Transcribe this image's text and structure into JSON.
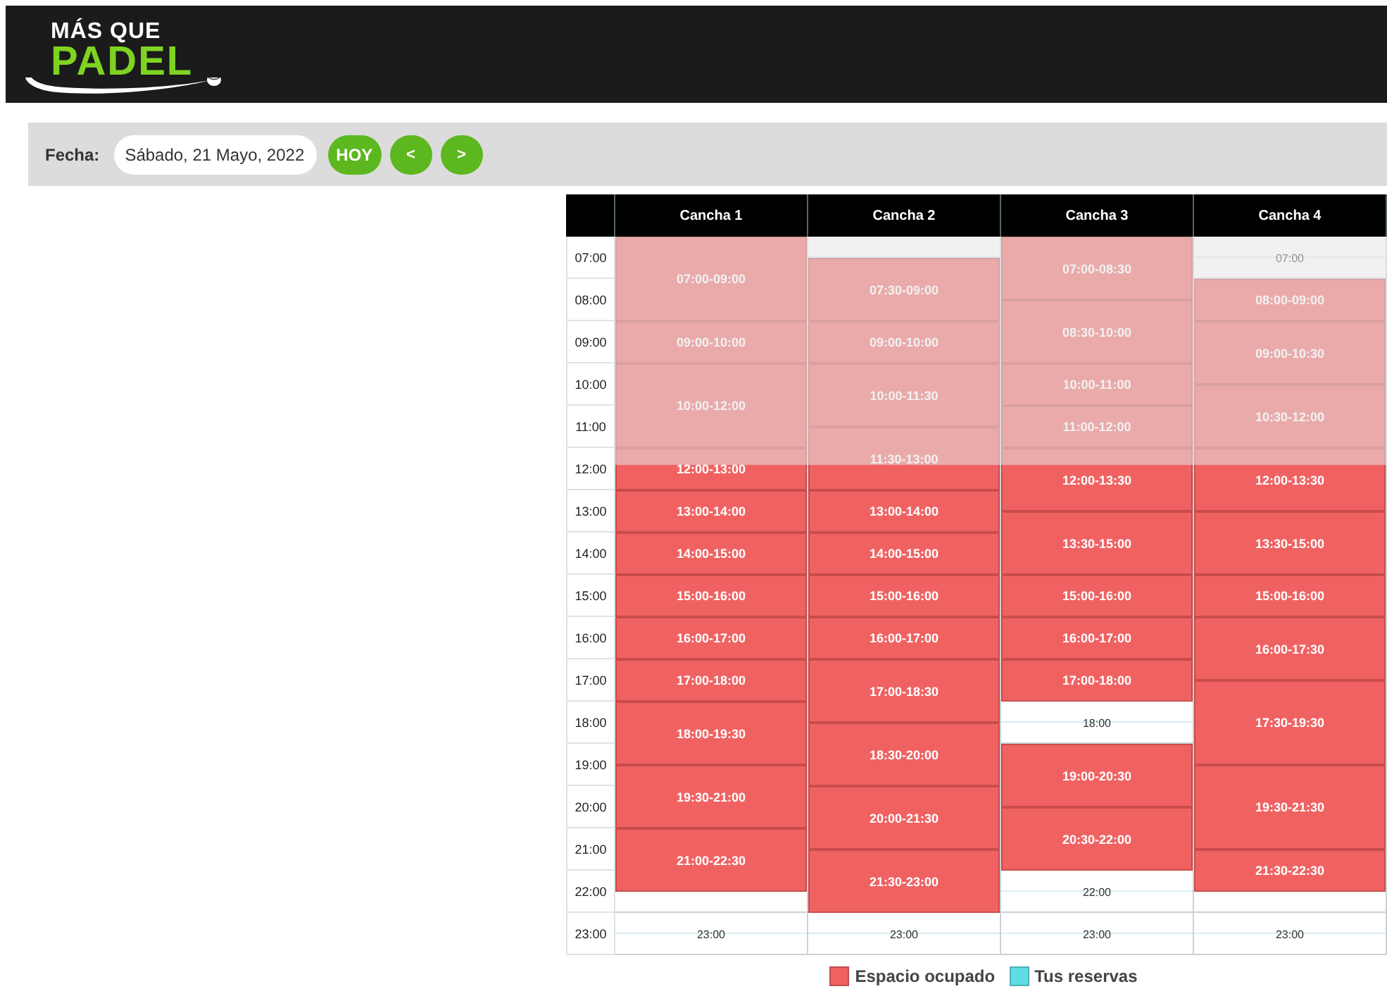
{
  "logo": {
    "line1": "MÁS QUE",
    "line2": "PADEL"
  },
  "toolbar": {
    "label": "Fecha:",
    "date_value": "Sábado, 21 Mayo, 2022",
    "buttons": [
      "HOY",
      "<",
      ">"
    ]
  },
  "schedule": {
    "hours": [
      "07:00",
      "08:00",
      "09:00",
      "10:00",
      "11:00",
      "12:00",
      "13:00",
      "14:00",
      "15:00",
      "16:00",
      "17:00",
      "18:00",
      "19:00",
      "20:00",
      "21:00",
      "22:00",
      "23:00"
    ],
    "courts": [
      {
        "name": "Cancha 1",
        "free_slots": [
          "23:00"
        ],
        "bookings": [
          "07:00-09:00",
          "09:00-10:00",
          "10:00-12:00",
          "12:00-13:00",
          "13:00-14:00",
          "14:00-15:00",
          "15:00-16:00",
          "16:00-17:00",
          "17:00-18:00",
          "18:00-19:30",
          "19:30-21:00",
          "21:00-22:30"
        ]
      },
      {
        "name": "Cancha 2",
        "free_slots": [
          "23:00"
        ],
        "bookings": [
          "07:30-09:00",
          "09:00-10:00",
          "10:00-11:30",
          "11:30-13:00",
          "13:00-14:00",
          "14:00-15:00",
          "15:00-16:00",
          "16:00-17:00",
          "17:00-18:30",
          "18:30-20:00",
          "20:00-21:30",
          "21:30-23:00"
        ]
      },
      {
        "name": "Cancha 3",
        "free_slots": [
          "18:00",
          "22:00",
          "23:00"
        ],
        "bookings": [
          "07:00-08:30",
          "08:30-10:00",
          "10:00-11:00",
          "11:00-12:00",
          "12:00-13:30",
          "13:30-15:00",
          "15:00-16:00",
          "16:00-17:00",
          "17:00-18:00",
          "19:00-20:30",
          "20:30-22:00"
        ]
      },
      {
        "name": "Cancha 4",
        "free_slots": [
          "07:00",
          "23:00"
        ],
        "bookings": [
          "08:00-09:00",
          "09:00-10:30",
          "10:30-12:00",
          "12:00-13:30",
          "13:30-15:00",
          "15:00-16:00",
          "16:00-17:30",
          "17:30-19:30",
          "19:30-21:30",
          "21:30-22:30"
        ]
      }
    ]
  },
  "legend": [
    {
      "label": "Espacio ocupado",
      "color": "#f06262"
    },
    {
      "label": "Tus reservas",
      "color": "#5fdde5"
    }
  ]
}
